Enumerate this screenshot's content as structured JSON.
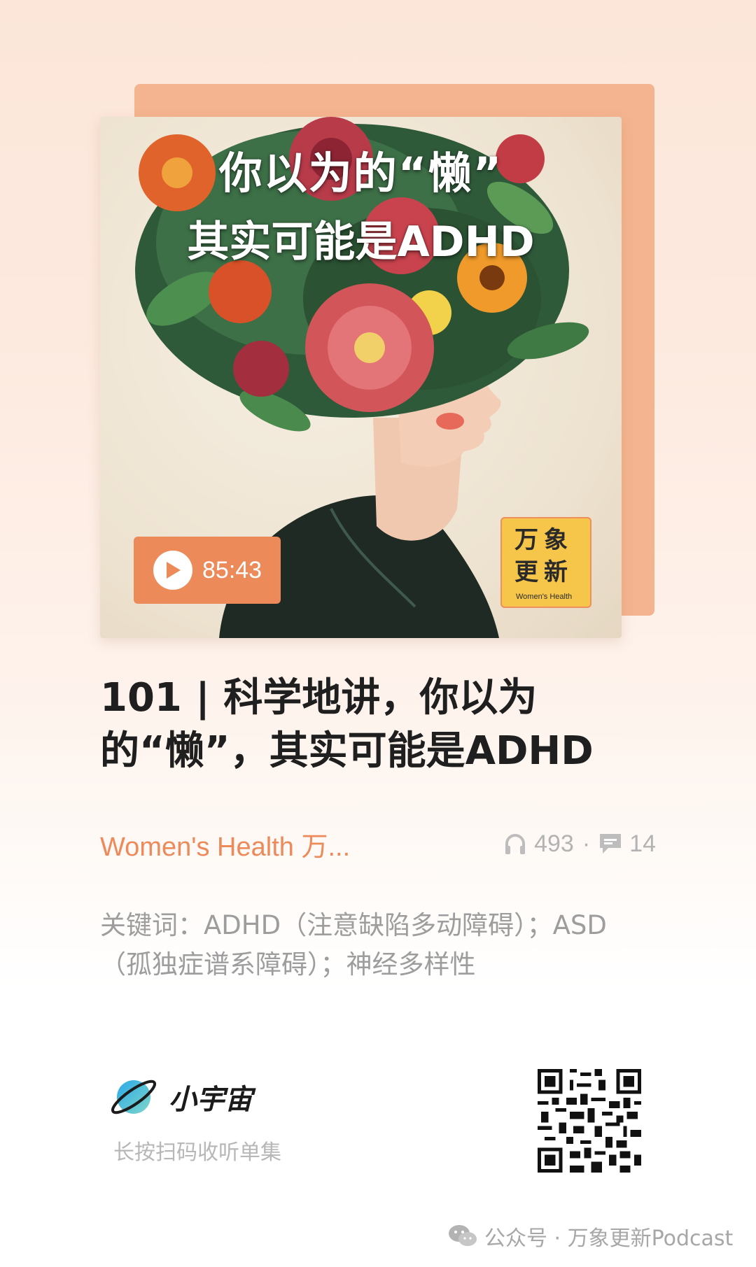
{
  "cover": {
    "title_line1": "你以为的“懒”",
    "title_line2": "其实可能是ADHD",
    "duration": "85:43",
    "brand_chars_line1": "万象",
    "brand_chars_line2": "更新",
    "brand_sub": "Women's Health"
  },
  "episode": {
    "title": "101 | 科学地讲，你以为的“懒”，其实可能是ADHD",
    "channel": "Women's Health 万...",
    "plays": "493",
    "stat_separator": "·",
    "comments": "14",
    "keywords": "关键词：ADHD（注意缺陷多动障碍）；ASD（孤独症谱系障碍）；神经多样性"
  },
  "footer_card": {
    "logo_text": "小宇宙",
    "scan_hint": "长按扫码收听单集"
  },
  "watermark": {
    "text": "公众号 · 万象更新Podcast"
  },
  "colors": {
    "accent": "#ec8a5a",
    "card_back": "#f4b48f",
    "badge": "#f6c64a",
    "title": "#1f1f1f",
    "muted": "#9d9d9d"
  },
  "icons": [
    "play-icon",
    "headphones-icon",
    "comment-icon",
    "planet-logo-icon",
    "wechat-icon",
    "qr-code"
  ]
}
